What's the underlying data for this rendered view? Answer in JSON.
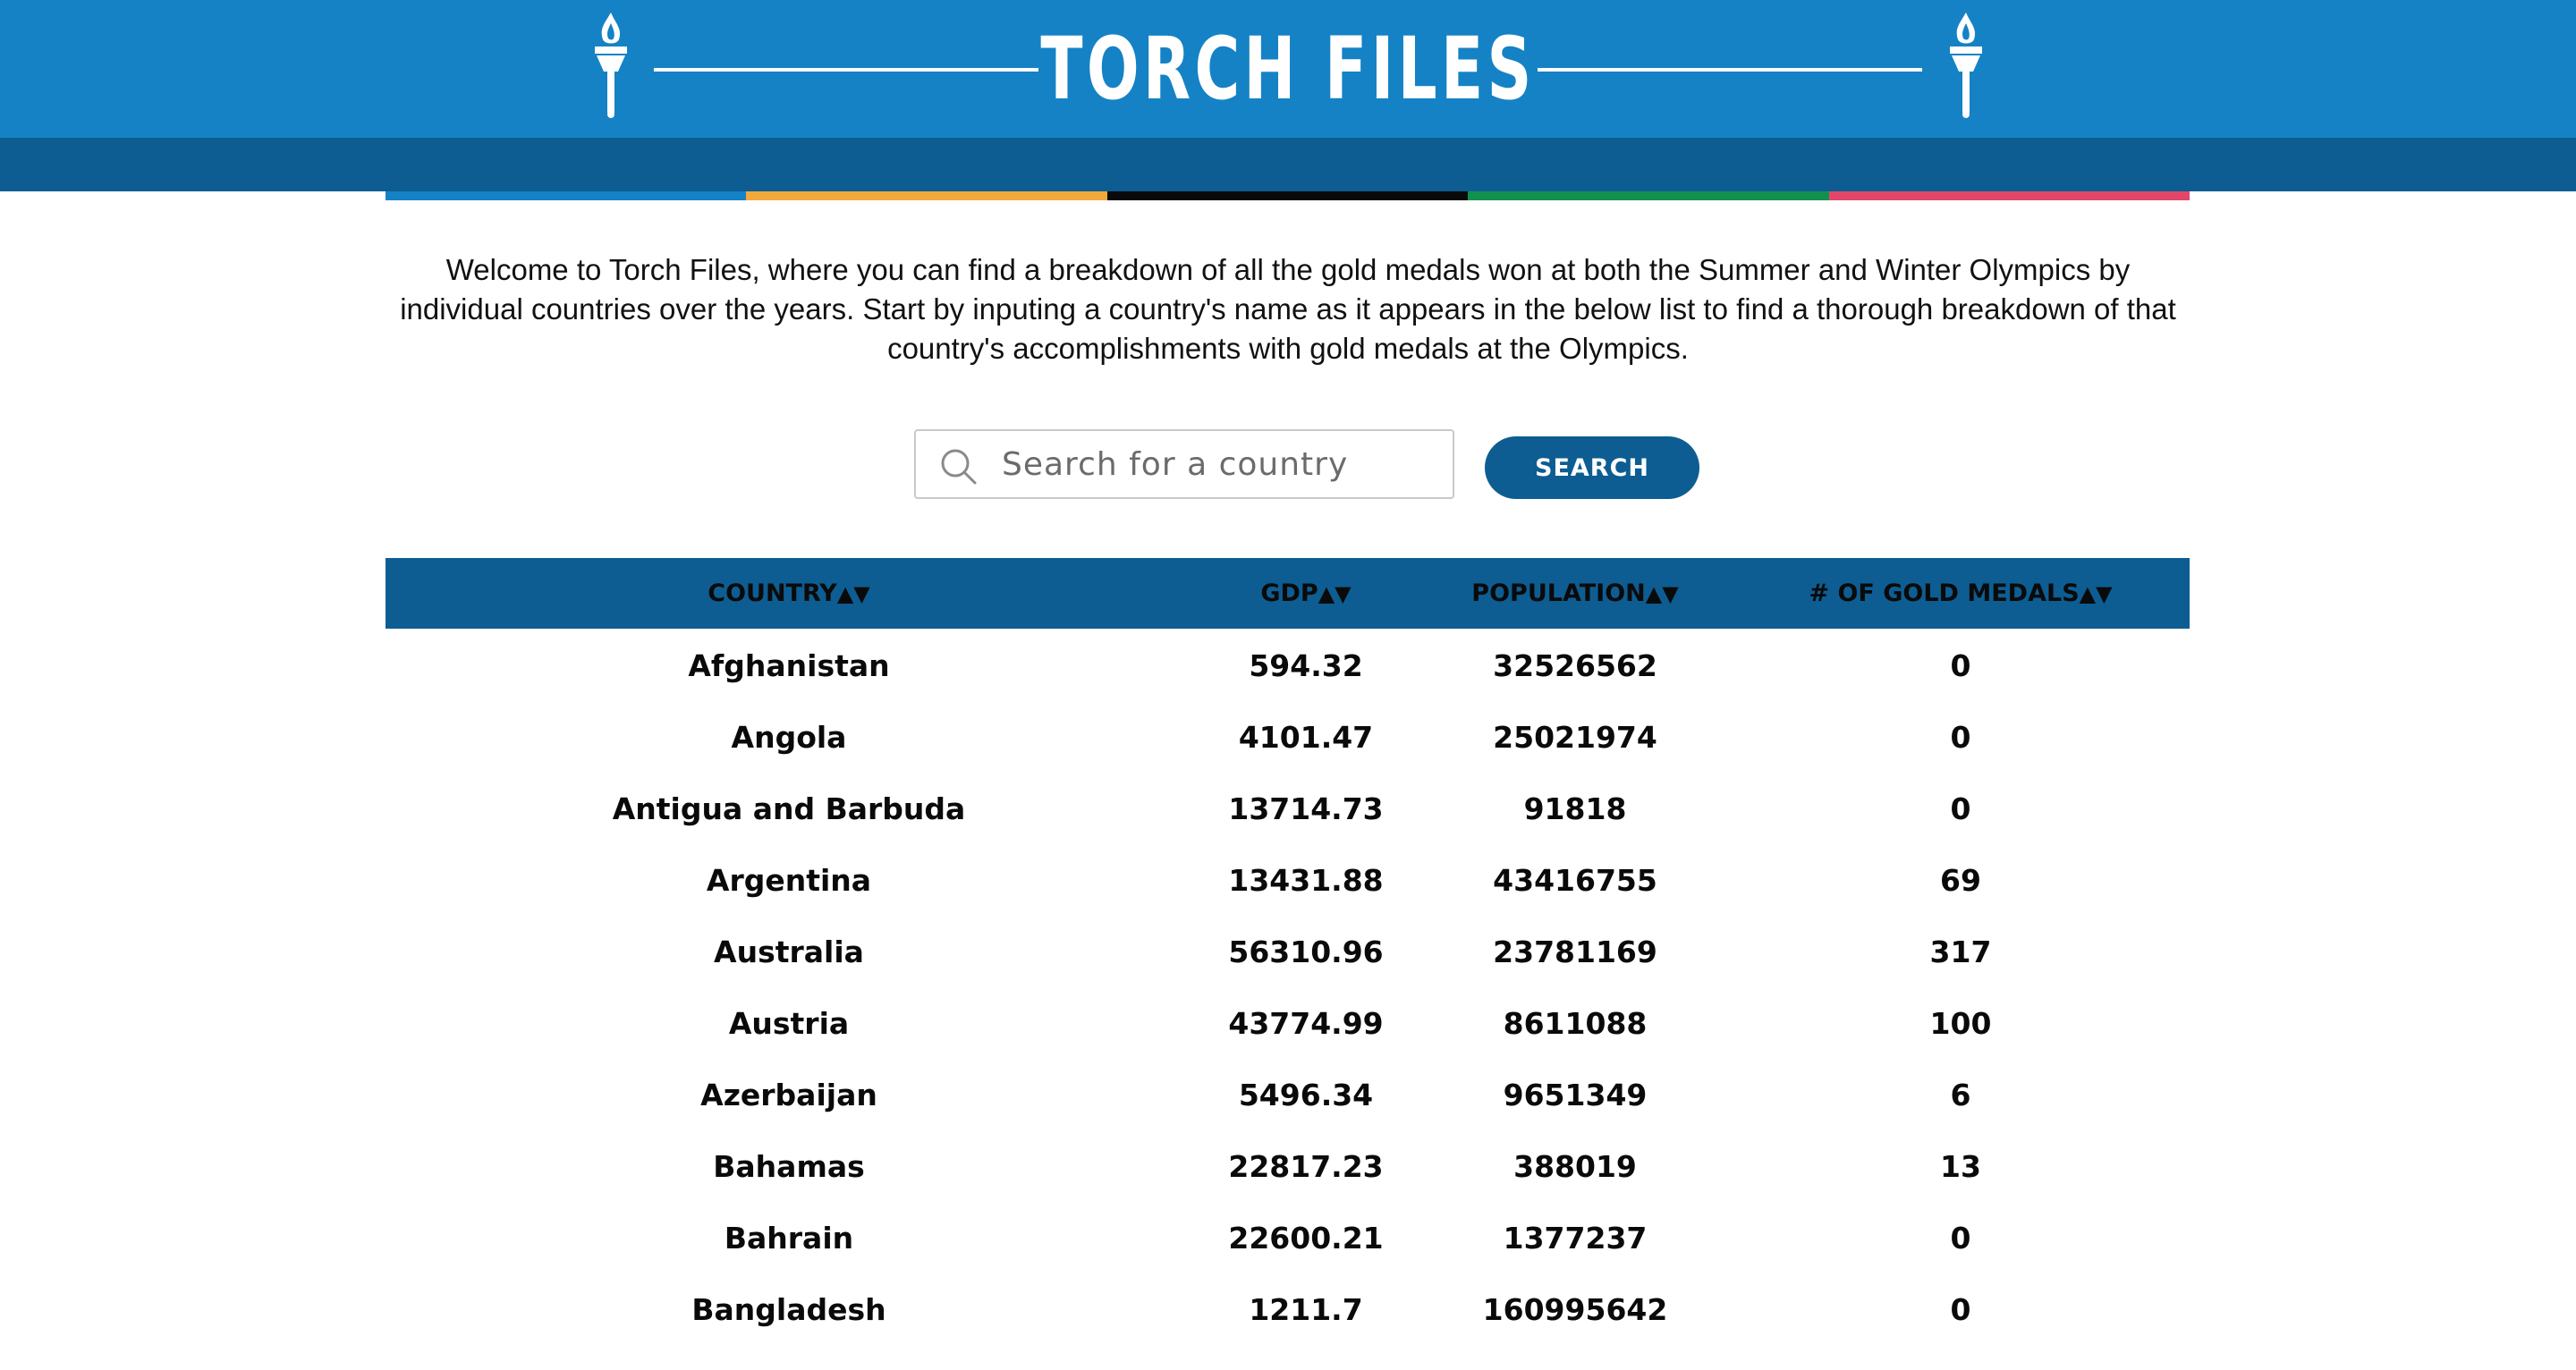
{
  "header": {
    "title": "TORCH FILES",
    "torch_icon": "torch-icon",
    "background_color": "#1582c5",
    "band_color": "#0d5d92"
  },
  "stripes": [
    "#1582c5",
    "#f0a93a",
    "#0a0a0a",
    "#13904e",
    "#e2476a"
  ],
  "intro": {
    "text": "Welcome to Torch Files, where you can find a breakdown of all the gold medals won at both the Summer and Winter Olympics by individual countries over the years. Start by inputing a country's name as it appears in the below list to find a thorough breakdown of that country's accomplishments with gold medals at the Olympics."
  },
  "search": {
    "placeholder": "Search for a country",
    "value": "",
    "icon": "search-icon",
    "button_label": "SEARCH"
  },
  "table": {
    "columns": [
      {
        "label": "COUNTRY",
        "sort": "▲▼"
      },
      {
        "label": "GDP",
        "sort": "▲▼"
      },
      {
        "label": "POPULATION",
        "sort": "▲▼"
      },
      {
        "label": "# OF GOLD MEDALS",
        "sort": "▲▼"
      }
    ],
    "rows": [
      [
        "Afghanistan",
        "594.32",
        "32526562",
        "0"
      ],
      [
        "Angola",
        "4101.47",
        "25021974",
        "0"
      ],
      [
        "Antigua and Barbuda",
        "13714.73",
        "91818",
        "0"
      ],
      [
        "Argentina",
        "13431.88",
        "43416755",
        "69"
      ],
      [
        "Australia",
        "56310.96",
        "23781169",
        "317"
      ],
      [
        "Austria",
        "43774.99",
        "8611088",
        "100"
      ],
      [
        "Azerbaijan",
        "5496.34",
        "9651349",
        "6"
      ],
      [
        "Bahamas",
        "22817.23",
        "388019",
        "13"
      ],
      [
        "Bahrain",
        "22600.21",
        "1377237",
        "0"
      ],
      [
        "Bangladesh",
        "1211.7",
        "160995642",
        "0"
      ]
    ]
  }
}
